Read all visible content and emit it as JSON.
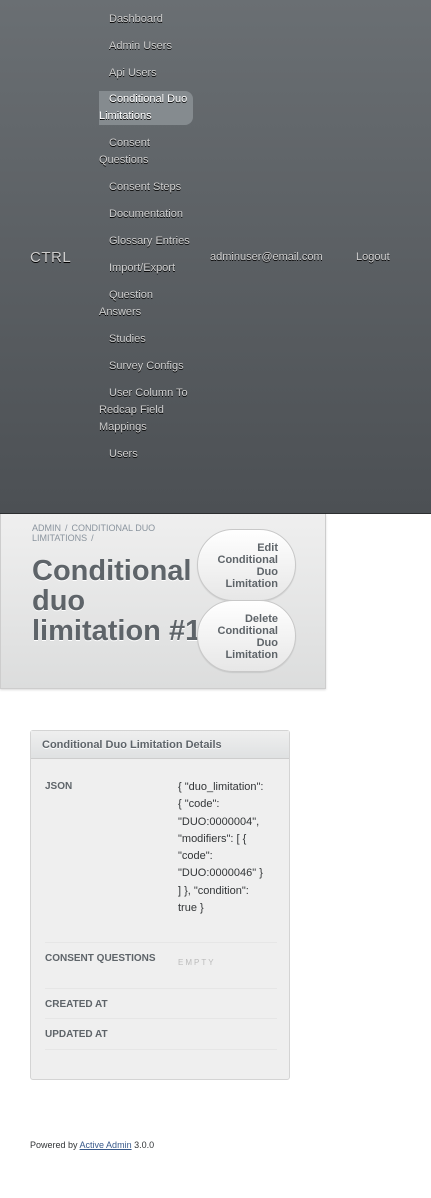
{
  "header": {
    "site_title": "CTRL",
    "tabs": [
      {
        "label": "Dashboard"
      },
      {
        "label": "Admin Users"
      },
      {
        "label": "Api Users"
      },
      {
        "label": "Conditional Duo Limitations",
        "current": true
      },
      {
        "label": "Consent Questions"
      },
      {
        "label": "Consent Steps"
      },
      {
        "label": "Documentation"
      },
      {
        "label": "Glossary Entries"
      },
      {
        "label": "Import/Export"
      },
      {
        "label": "Question Answers"
      },
      {
        "label": "Studies"
      },
      {
        "label": "Survey Configs"
      },
      {
        "label": "User Column To Redcap Field Mappings"
      },
      {
        "label": "Users"
      }
    ],
    "current_user": "adminuser@email.com",
    "logout_label": "Logout"
  },
  "breadcrumb": {
    "items": [
      "Admin",
      "Conditional Duo Limitations"
    ],
    "separator": "/"
  },
  "page_title": "Conditional duo limitation #1",
  "actions": {
    "edit_label": "Edit Conditional Duo Limitation",
    "delete_label": "Delete Conditional Duo Limitation"
  },
  "panel": {
    "title": "Conditional Duo Limitation Details",
    "rows": [
      {
        "label": "Json",
        "value": "{ \"duo_limitation\": { \"code\": \"DUO:0000004\", \"modifiers\": [ { \"code\": \"DUO:0000046\" } ] }, \"condition\": true }"
      },
      {
        "label": "Consent Questions",
        "value": "Empty"
      },
      {
        "label": "Created At",
        "value": ""
      },
      {
        "label": "Updated At",
        "value": ""
      }
    ]
  },
  "footer": {
    "prefix": "Powered by",
    "link_text": "Active Admin",
    "version": "3.0.0"
  },
  "colors": {
    "header_top": "#6a6f73",
    "header_bottom": "#4c5054",
    "current_tab": "#858b8f",
    "link": "#38598a"
  }
}
